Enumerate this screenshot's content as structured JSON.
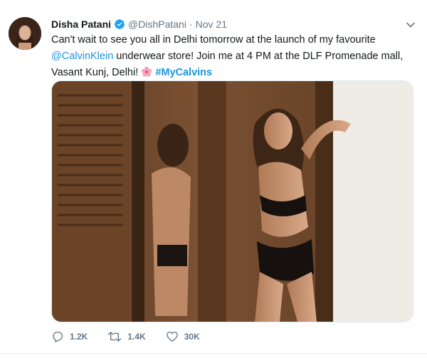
{
  "tweet": {
    "author_name": "Disha Patani",
    "handle": "@DishPatani",
    "separator": "·",
    "date": "Nov 21",
    "text": {
      "part1": "Can't wait to see you all in Delhi tomorrow at the launch of my favourite ",
      "mention": "@CalvinKlein",
      "part2": " underwear store! Join me at 4 PM at the DLF Promenade mall, Vasant Kunj, Delhi! ",
      "hashtag": "#MyCalvins"
    },
    "stats": {
      "replies": "1.2K",
      "retweets": "1.4K",
      "likes": "30K"
    }
  },
  "icons": {
    "verified": "verified-badge-icon",
    "chevron": "chevron-down-icon",
    "flower": "cherry-blossom-emoji-icon",
    "reply": "reply-icon",
    "retweet": "retweet-icon",
    "like": "heart-icon"
  },
  "colors": {
    "link": "#1b95e0",
    "secondary_text": "#657786",
    "border": "#e1e8ed"
  }
}
